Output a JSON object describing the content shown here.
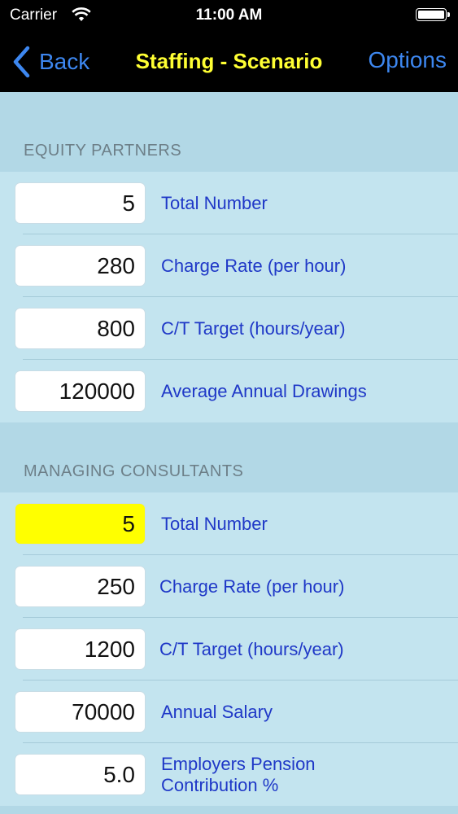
{
  "status_bar": {
    "carrier": "Carrier",
    "time": "11:00 AM"
  },
  "nav": {
    "back_label": "Back",
    "title": "Staffing - Scenario",
    "options_label": "Options"
  },
  "colors": {
    "accent": "#3d87f0",
    "title": "#ffff33",
    "label": "#1f38c7",
    "highlight": "#ffff00"
  },
  "sections": [
    {
      "header": "EQUITY PARTNERS",
      "rows": [
        {
          "value": "5",
          "label": "Total Number"
        },
        {
          "value": "280",
          "label": "Charge Rate (per hour)"
        },
        {
          "value": "800",
          "label": "C/T Target (hours/year)"
        },
        {
          "value": "120000",
          "label": "Average Annual Drawings"
        }
      ]
    },
    {
      "header": "MANAGING CONSULTANTS",
      "rows": [
        {
          "value": "5",
          "label": "Total Number",
          "highlighted": true
        },
        {
          "value": "250",
          "label": "Charge Rate (per hour)"
        },
        {
          "value": "1200",
          "label": "C/T Target (hours/year)"
        },
        {
          "value": "70000",
          "label": "Annual Salary"
        },
        {
          "value": "5.0",
          "label": "Employers Pension Contribution %"
        }
      ]
    }
  ]
}
